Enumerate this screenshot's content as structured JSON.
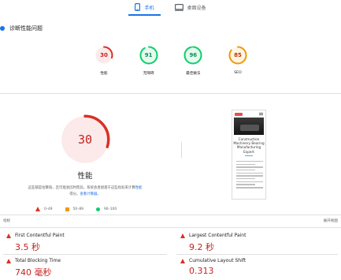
{
  "tabs": [
    {
      "label": "手机",
      "icon": "phone-icon",
      "active": true
    },
    {
      "label": "桌面设备",
      "icon": "desktop-icon",
      "active": false
    }
  ],
  "diagnose": {
    "label": "诊断性能问题"
  },
  "categories": [
    {
      "label": "性能",
      "score": "30",
      "value": 30,
      "color": "#d93025"
    },
    {
      "label": "无障碍",
      "score": "91",
      "value": 91,
      "color": "#0cce6b"
    },
    {
      "label": "最佳做法",
      "score": "96",
      "value": 96,
      "color": "#0cce6b"
    },
    {
      "label": "SEO",
      "score": "85",
      "value": 85,
      "color": "#f29900"
    }
  ],
  "performance": {
    "score": "30",
    "value": 30,
    "title": "性能",
    "desc_line1": "这些都是估算值，且可能会因时而异。系统会直接基于这些指标来计算",
    "desc_link1": "性能",
    "desc_line2_start": "得分。",
    "desc_link2": "查看计算器。",
    "legend": [
      {
        "shape": "triangle",
        "range": "0–49",
        "color": "#d93025"
      },
      {
        "shape": "square",
        "range": "50–89",
        "color": "#f29900"
      },
      {
        "shape": "circle",
        "range": "90–100",
        "color": "#0cce6b"
      }
    ]
  },
  "screenshot": {
    "title": "Construction Machinery Bearing Manufacturing Expert"
  },
  "metrics": {
    "header": "指标",
    "expand_label": "展开视图",
    "items": [
      {
        "label": "First Contentful Paint",
        "value": "3.5 秒"
      },
      {
        "label": "Largest Contentful Paint",
        "value": "9.2 秒"
      },
      {
        "label": "Total Blocking Time",
        "value": "740 毫秒"
      },
      {
        "label": "Cumulative Layout Shift",
        "value": "0.313"
      }
    ]
  },
  "colors": {
    "accent": "#1a73e8",
    "fail": "#d93025",
    "average": "#f29900",
    "pass": "#0cce6b"
  }
}
